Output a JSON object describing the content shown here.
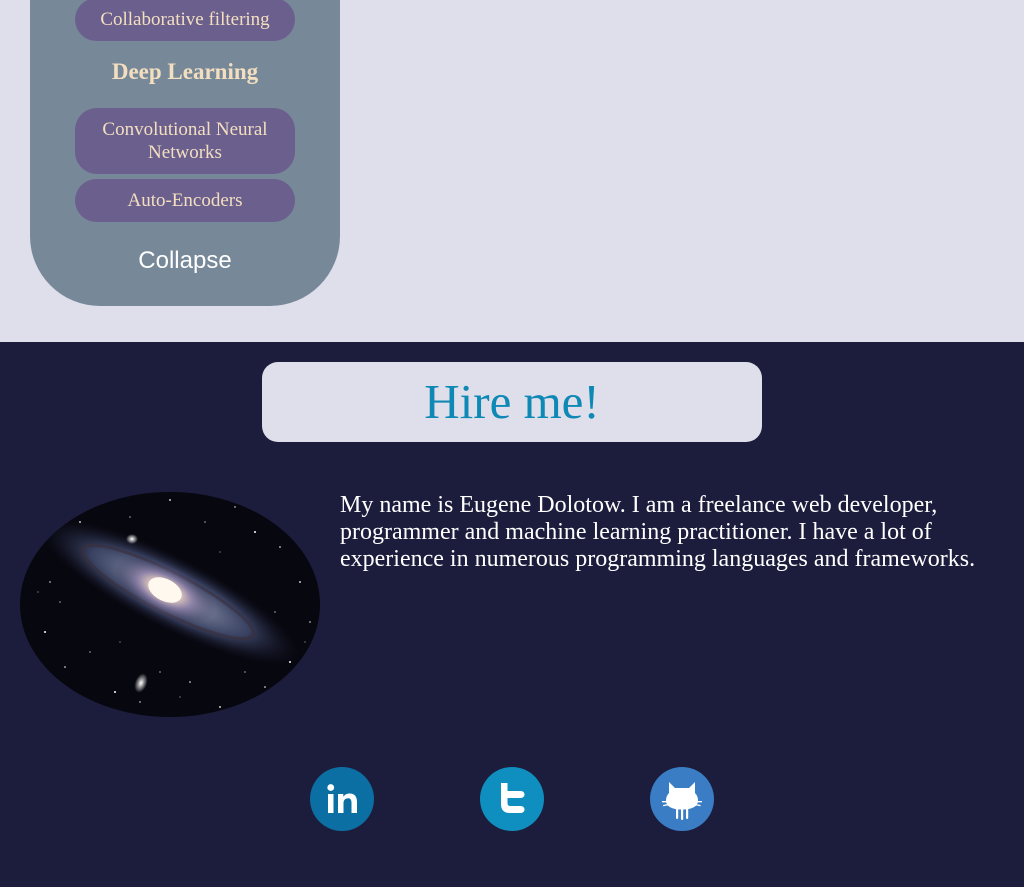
{
  "sidebar": {
    "items_before": [
      {
        "label": "Collaborative filtering"
      }
    ],
    "section_heading": "Deep Learning",
    "items": [
      {
        "label": "Convolutional Neural Networks"
      },
      {
        "label": "Auto-Encoders"
      }
    ],
    "collapse_label": "Collapse"
  },
  "hire": {
    "title": "Hire me!",
    "bio": "My name is Eugene Dolotow. I am a freelance web developer, programmer and machine learning practitioner. I have a lot of experience in numerous programming languages and frameworks."
  },
  "social": [
    {
      "icon": "linkedin-icon",
      "color": "#0c6fa3"
    },
    {
      "icon": "twitter-icon",
      "color": "#0f8fbf"
    },
    {
      "icon": "github-icon",
      "color": "#3a7dc4"
    }
  ],
  "colors": {
    "page_background": "#dedfea",
    "sidebar_panel": "#778899",
    "pill_background": "#6b5f8d",
    "pill_text": "#f3dfc0",
    "footer_background": "#1c1c3c",
    "hire_title": "#0e88b5"
  }
}
